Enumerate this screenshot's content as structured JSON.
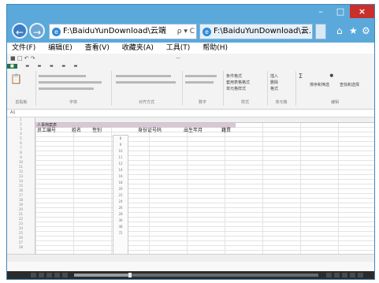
{
  "browser": {
    "address": {
      "text": "F:\\BaiduYunDownload\\云端",
      "controls": "ρ ▾ C"
    },
    "tab": {
      "label": "F:\\BaiduYunDownload\\云...",
      "close": "×"
    },
    "window": {
      "min": "–",
      "max": "□",
      "close": "×"
    },
    "icons": [
      "home-icon",
      "star-icon",
      "gear-icon"
    ]
  },
  "menu": {
    "items": [
      "文件(F)",
      "编辑(E)",
      "查看(V)",
      "收藏夹(A)",
      "工具(T)",
      "帮助(H)"
    ]
  },
  "excel": {
    "title_row": "人事档案表",
    "headers": [
      "员工编号",
      "姓名",
      "性别",
      "身份证号码",
      "出生年月",
      "籍贯"
    ],
    "ribbon": {
      "labels": [
        "剪贴板",
        "字体",
        "对齐方式",
        "数字",
        "样式",
        "单元格",
        "编辑"
      ],
      "cmds": [
        "条件格式",
        "套用表格格式",
        "单元格样式",
        "插入",
        "删除",
        "格式",
        "排序和筛选",
        "查找和选择"
      ]
    },
    "formula_ref": "A1"
  },
  "player": {
    "progress": 0.23
  }
}
